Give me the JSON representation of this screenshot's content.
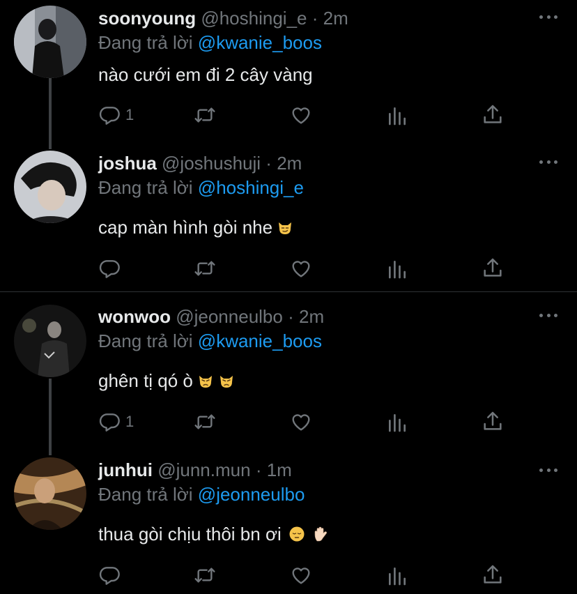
{
  "tweets": [
    {
      "name": "soonyoung",
      "handle": "@hoshingi_e",
      "dot": "·",
      "time": "2m",
      "replying_prefix": "Đang trả lời",
      "replying_to": "@kwanie_boos",
      "text": "nào cưới em đi 2 cây vàng",
      "reply_count": "1"
    },
    {
      "name": "joshua",
      "handle": "@joshushuji",
      "dot": "·",
      "time": "2m",
      "replying_prefix": "Đang trả lời",
      "replying_to": "@hoshingi_e",
      "text": "cap màn hình gòi nhe",
      "reply_count": ""
    },
    {
      "name": "wonwoo",
      "handle": "@jeonneulbo",
      "dot": "·",
      "time": "2m",
      "replying_prefix": "Đang trả lời",
      "replying_to": "@kwanie_boos",
      "text": "ghên tị qó ò",
      "reply_count": "1"
    },
    {
      "name": "junhui",
      "handle": "@junn.mun",
      "dot": "·",
      "time": "1m",
      "replying_prefix": "Đang trả lời",
      "replying_to": "@jeonneulbo",
      "text": "thua gòi chịu thôi bn ơi",
      "reply_count": ""
    }
  ],
  "icons": [
    "reply-icon",
    "retweet-icon",
    "like-icon",
    "analytics-icon",
    "share-icon",
    "more-icon"
  ],
  "colors": {
    "background": "#000000",
    "text": "#e7e9ea",
    "muted": "#71767b",
    "mention": "#1d9bf0",
    "divider": "#2f3336"
  }
}
